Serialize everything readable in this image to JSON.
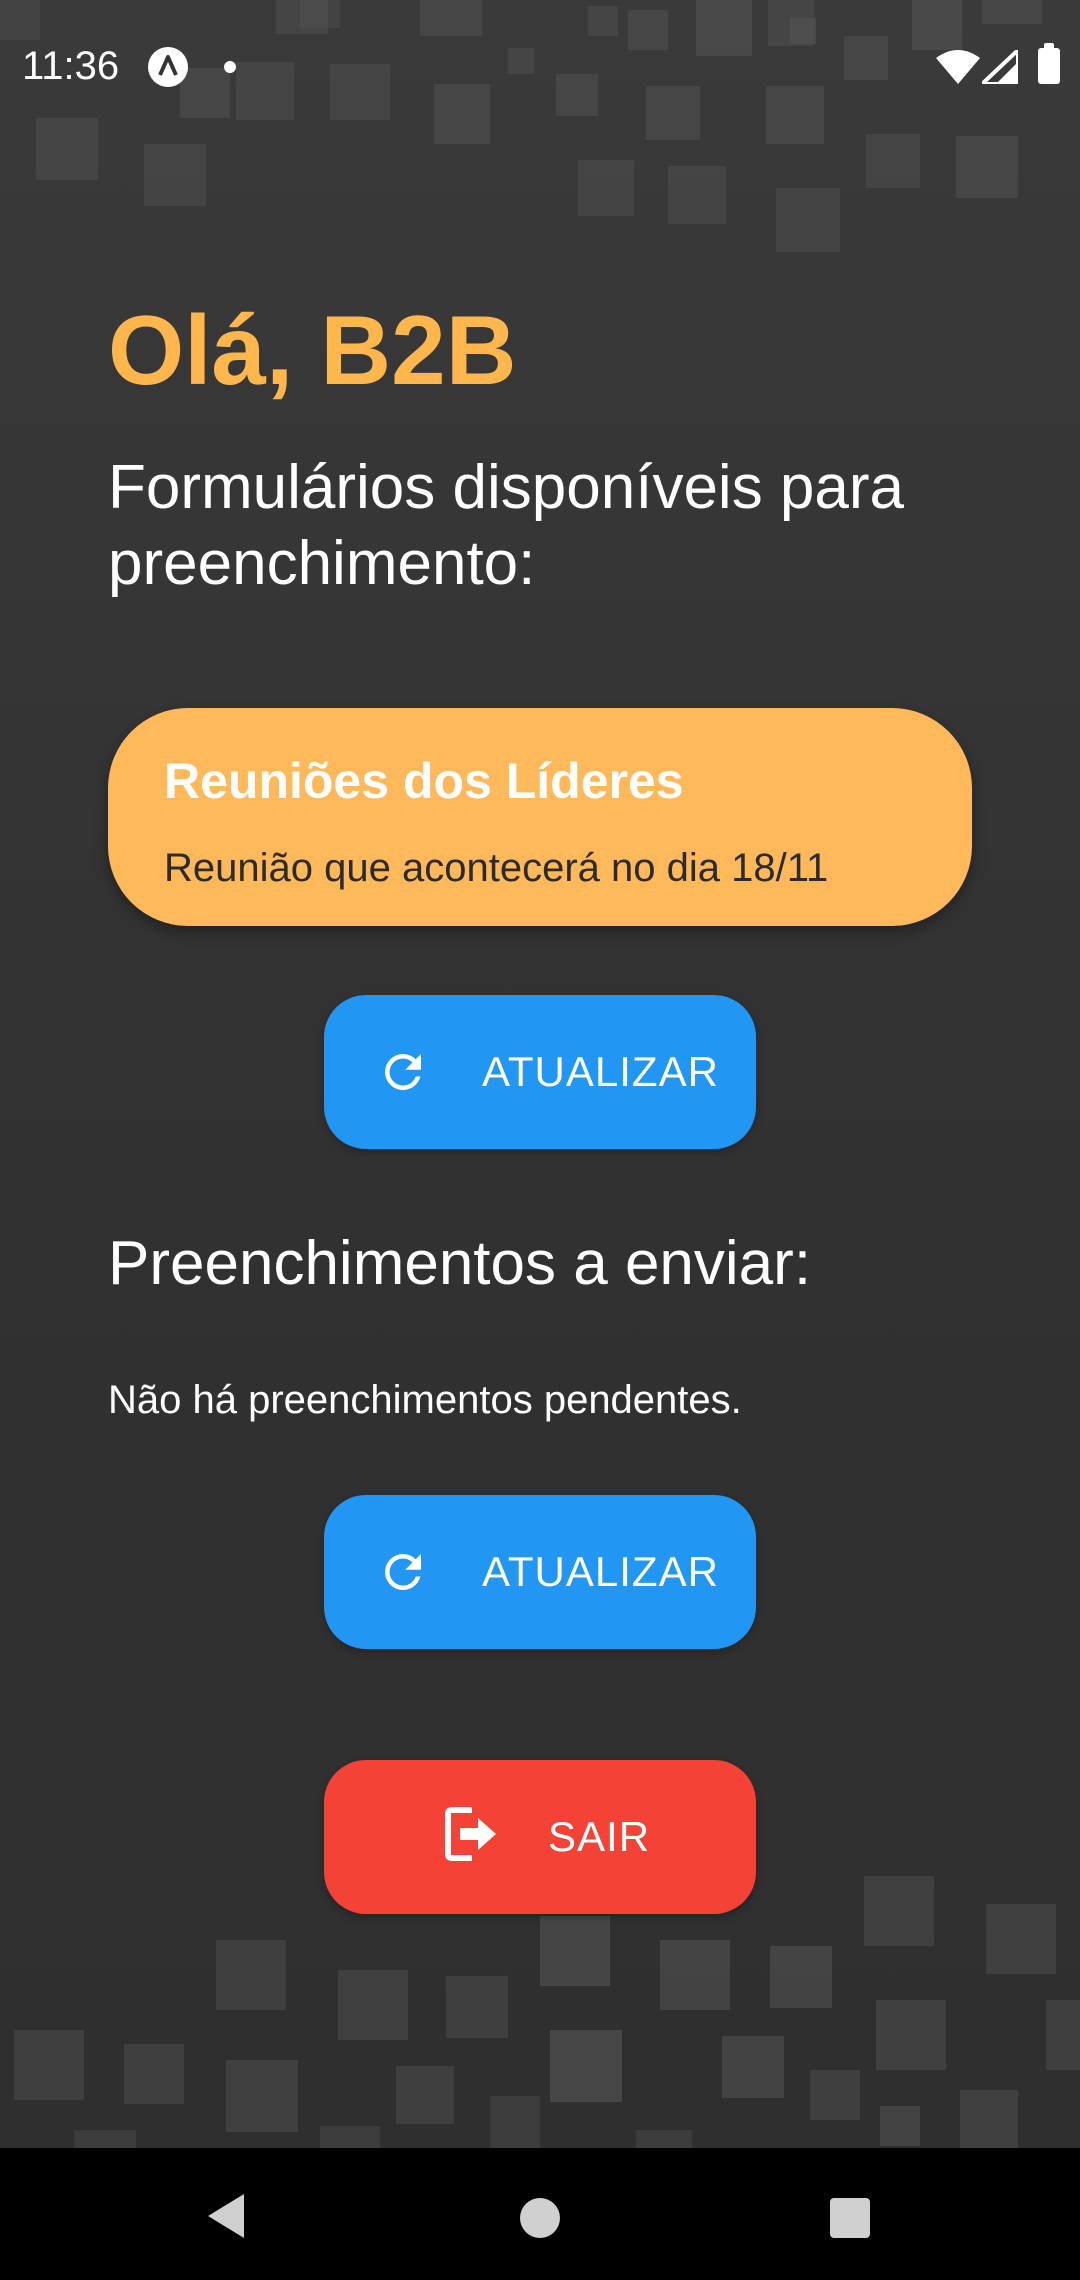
{
  "status_bar": {
    "time": "11:36",
    "app_icon": "android-notification-icon",
    "icons": [
      "wifi-icon",
      "signal-icon",
      "battery-icon"
    ]
  },
  "header": {
    "greeting": "Olá, B2B",
    "forms_heading": "Formulários disponíveis para preenchimento:"
  },
  "forms": [
    {
      "title": "Reuniões dos Líderes",
      "description": "Reunião que acontecerá no dia 18/11"
    }
  ],
  "refresh_forms_button": {
    "label": "ATUALIZAR",
    "icon": "refresh-icon"
  },
  "pending": {
    "heading": "Preenchimentos a enviar:",
    "empty_text": "Não há preenchimentos pendentes."
  },
  "refresh_pending_button": {
    "label": "ATUALIZAR",
    "icon": "refresh-icon"
  },
  "exit_button": {
    "label": "SAIR",
    "icon": "exit-icon"
  },
  "nav_bar": {
    "icons": [
      "back-icon",
      "home-icon",
      "recents-icon"
    ]
  },
  "colors": {
    "background": "#343434",
    "greeting": "#ffb74d",
    "card": "#ffb95a",
    "primary_button": "#2196f3",
    "exit_button": "#f44336"
  }
}
